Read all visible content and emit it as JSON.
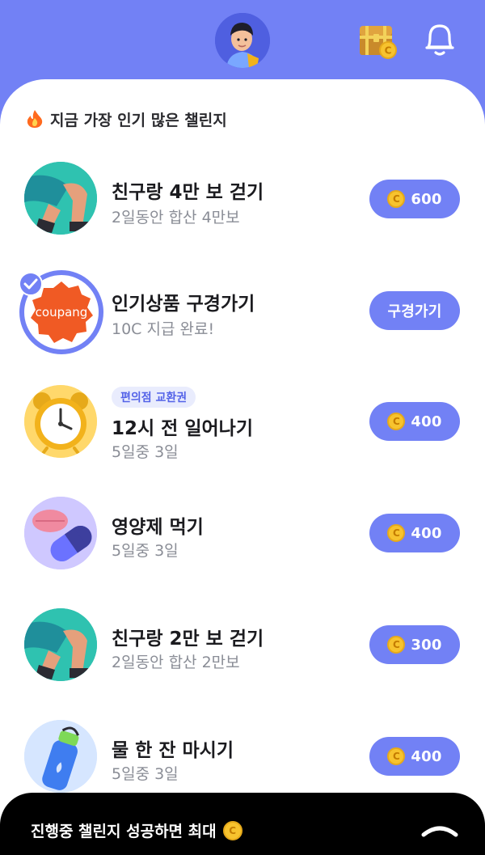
{
  "header": {
    "avatar_icon": "user-avatar-3d",
    "chest_icon": "treasure-chest-coin-icon",
    "bell_icon": "bell-icon"
  },
  "section": {
    "title": "지금 가장 인기 많은 챌린지",
    "icon": "fire-icon"
  },
  "coin_glyph": "C",
  "items": [
    {
      "title": "친구랑 4만 보 걷기",
      "subtitle": "2일동안 합산 4만보",
      "tag": "",
      "button": "600",
      "button_type": "coin",
      "thumb": "walking-legs",
      "thumb_bg": "#2bb5a6"
    },
    {
      "title": "인기상품 구경가기",
      "subtitle": "10C 지급 완료!",
      "tag": "",
      "button": "구경가기",
      "button_type": "text",
      "thumb": "coupang-logo",
      "thumb_bg": "#ffffff",
      "logo_text": "coupang"
    },
    {
      "title": "12시 전 일어나기",
      "subtitle": "5일중 3일",
      "tag": "편의점 교환권",
      "button": "400",
      "button_type": "coin",
      "thumb": "alarm-clock",
      "thumb_bg": "#ffe29a"
    },
    {
      "title": "영양제 먹기",
      "subtitle": "5일중 3일",
      "tag": "",
      "button": "400",
      "button_type": "coin",
      "thumb": "pills",
      "thumb_bg": "#c7c4ff"
    },
    {
      "title": "친구랑 2만 보 걷기",
      "subtitle": "2일동안 합산 2만보",
      "tag": "",
      "button": "300",
      "button_type": "coin",
      "thumb": "walking-legs",
      "thumb_bg": "#2bb5a6"
    },
    {
      "title": "물 한 잔 마시기",
      "subtitle": "5일중 3일",
      "tag": "",
      "button": "400",
      "button_type": "coin",
      "thumb": "water-bottle",
      "thumb_bg": "#cfe3ff"
    }
  ],
  "bottom_bar": {
    "text": "진행중 챌린지 성공하면 최대",
    "chevron_icon": "chevron-up-icon"
  },
  "colors": {
    "accent": "#7281f5",
    "tag_bg": "#e9ecfd",
    "coin": "#f7c32e"
  }
}
